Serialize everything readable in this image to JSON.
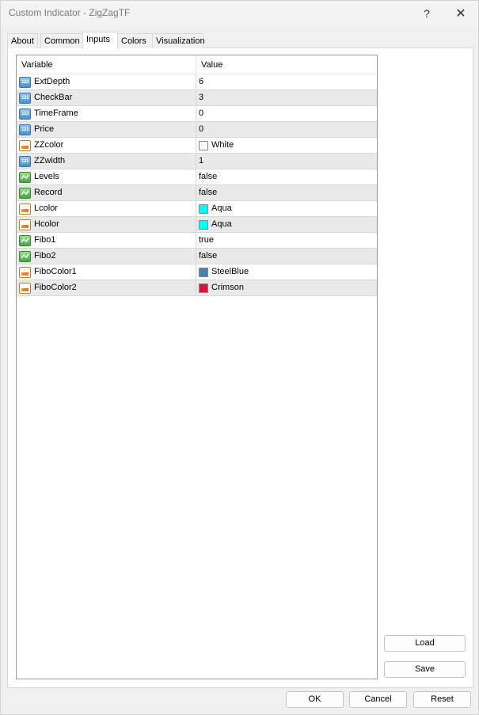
{
  "window": {
    "title": "Custom Indicator - ZigZagTF",
    "help_label": "?",
    "close_label": "✕"
  },
  "tabs": [
    {
      "label": "About",
      "active": false
    },
    {
      "label": "Common",
      "active": false
    },
    {
      "label": "Inputs",
      "active": true
    },
    {
      "label": "Colors",
      "active": false
    },
    {
      "label": "Visualization",
      "active": false
    }
  ],
  "grid": {
    "headers": {
      "variable": "Variable",
      "value": "Value"
    },
    "rows": [
      {
        "name": "ExtDepth",
        "type": "int",
        "icon": "integer-type-icon",
        "value": "6"
      },
      {
        "name": "CheckBar",
        "type": "int",
        "icon": "integer-type-icon",
        "value": "3"
      },
      {
        "name": "TimeFrame",
        "type": "int",
        "icon": "integer-type-icon",
        "value": "0"
      },
      {
        "name": "Price",
        "type": "int",
        "icon": "integer-type-icon",
        "value": "0"
      },
      {
        "name": "ZZcolor",
        "type": "color",
        "icon": "color-type-icon",
        "value": "White",
        "swatch": "#ffffff"
      },
      {
        "name": "ZZwidth",
        "type": "int",
        "icon": "integer-type-icon",
        "value": "1"
      },
      {
        "name": "Levels",
        "type": "bool",
        "icon": "boolean-type-icon",
        "value": "false"
      },
      {
        "name": "Record",
        "type": "bool",
        "icon": "boolean-type-icon",
        "value": "false"
      },
      {
        "name": "Lcolor",
        "type": "color",
        "icon": "color-type-icon",
        "value": "Aqua",
        "swatch": "#00ffff"
      },
      {
        "name": "Hcolor",
        "type": "color",
        "icon": "color-type-icon",
        "value": "Aqua",
        "swatch": "#00ffff"
      },
      {
        "name": "Fibo1",
        "type": "bool",
        "icon": "boolean-type-icon",
        "value": "true"
      },
      {
        "name": "Fibo2",
        "type": "bool",
        "icon": "boolean-type-icon",
        "value": "false"
      },
      {
        "name": "FiboColor1",
        "type": "color",
        "icon": "color-type-icon",
        "value": "SteelBlue",
        "swatch": "#4682b4"
      },
      {
        "name": "FiboColor2",
        "type": "color",
        "icon": "color-type-icon",
        "value": "Crimson",
        "swatch": "#dc143c"
      }
    ]
  },
  "icon_text": {
    "int": "123"
  },
  "buttons": {
    "load": "Load",
    "save": "Save",
    "ok": "OK",
    "cancel": "Cancel",
    "reset": "Reset"
  }
}
